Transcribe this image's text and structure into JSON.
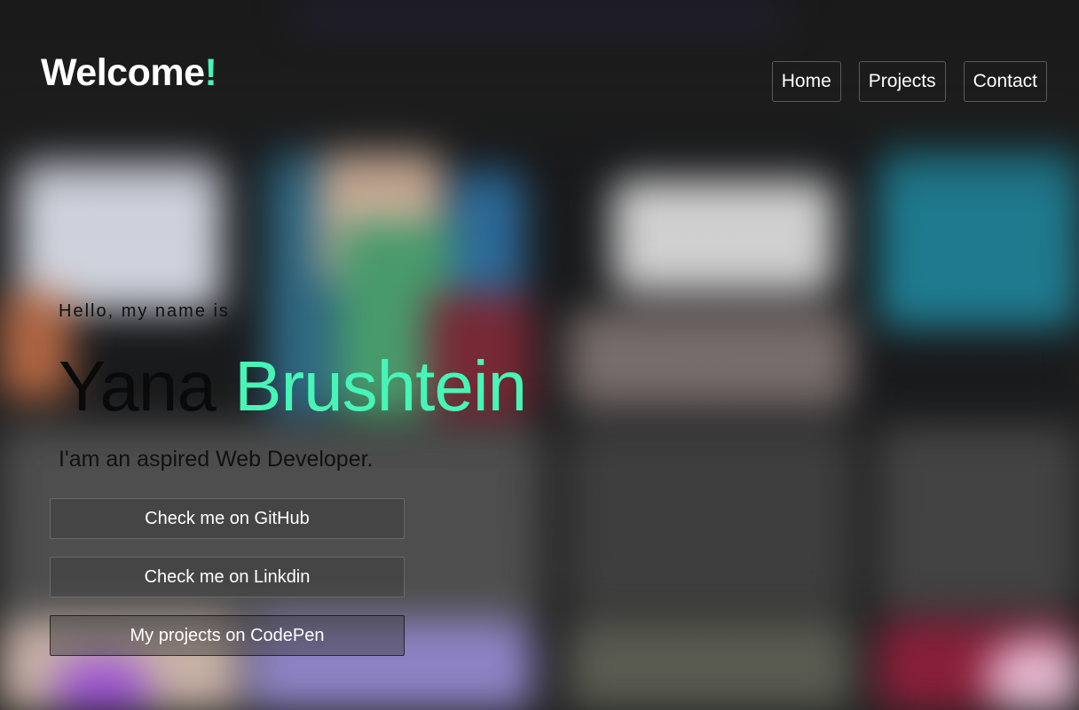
{
  "header": {
    "logo_text": "Welcome",
    "logo_accent": "!",
    "nav": [
      {
        "label": "Home"
      },
      {
        "label": "Projects"
      },
      {
        "label": "Contact"
      }
    ]
  },
  "hero": {
    "greeting": "Hello, my name is",
    "first_name": "Yana",
    "last_name": "Brushtein",
    "tagline": "I'am an aspired Web Developer."
  },
  "actions": [
    {
      "label": "Check me on GitHub"
    },
    {
      "label": "Check me on Linkdin"
    },
    {
      "label": "My projects on CodePen"
    }
  ],
  "colors": {
    "accent": "#47f5b7",
    "background": "#202020"
  }
}
